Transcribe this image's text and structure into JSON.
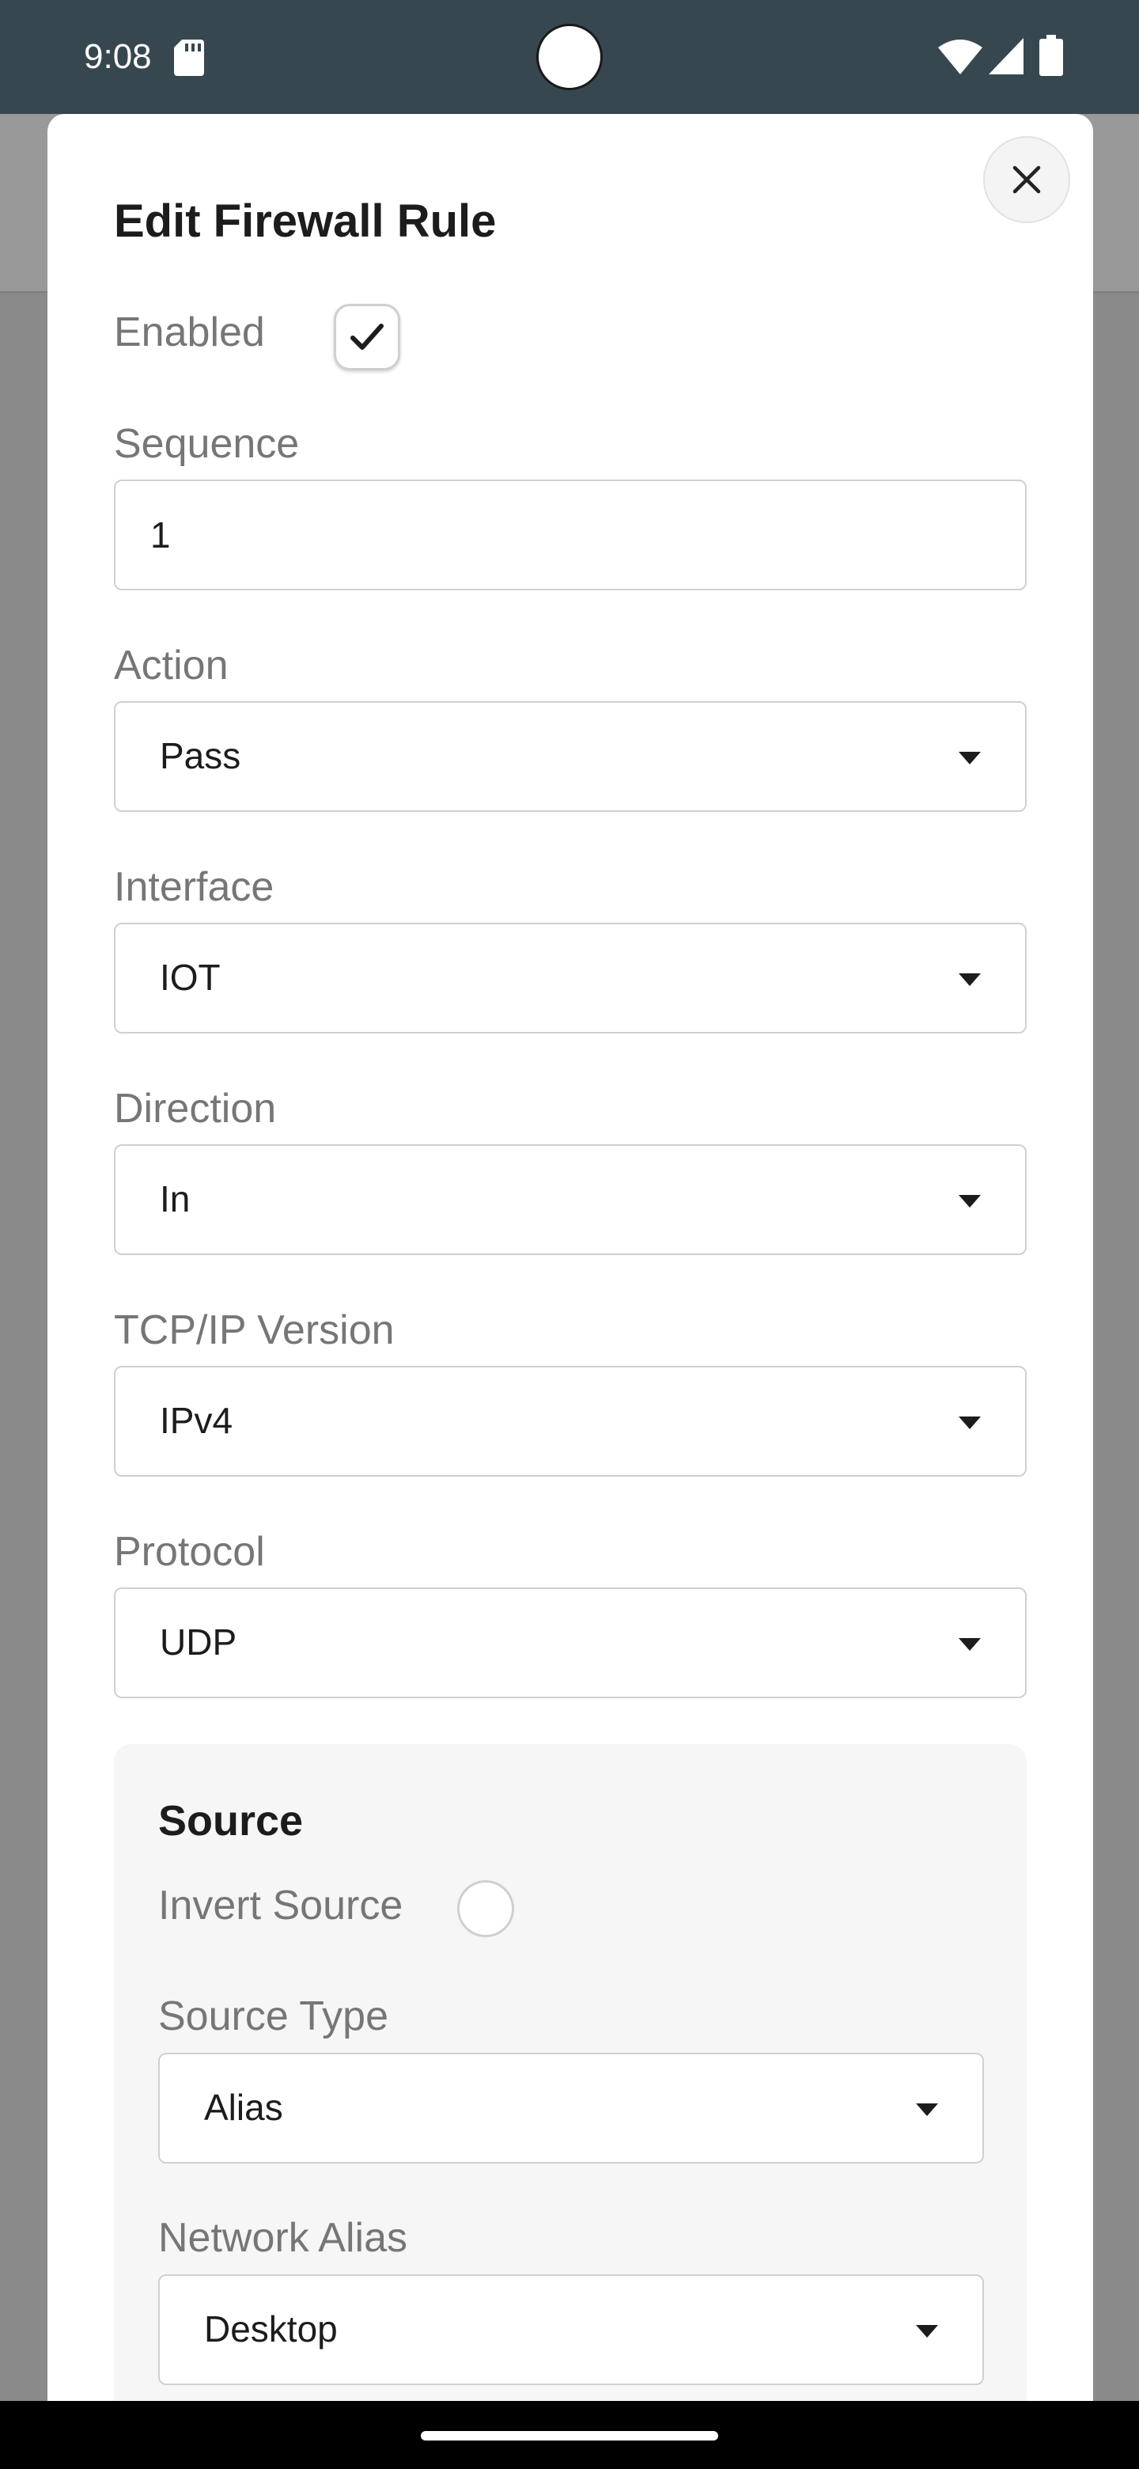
{
  "status_bar": {
    "time": "9:08"
  },
  "modal": {
    "title": "Edit Firewall Rule"
  },
  "form": {
    "enabled": {
      "label": "Enabled",
      "checked": true
    },
    "sequence": {
      "label": "Sequence",
      "value": "1"
    },
    "action": {
      "label": "Action",
      "value": "Pass"
    },
    "interface": {
      "label": "Interface",
      "value": "IOT"
    },
    "direction": {
      "label": "Direction",
      "value": "In"
    },
    "tcpip_version": {
      "label": "TCP/IP Version",
      "value": "IPv4"
    },
    "protocol": {
      "label": "Protocol",
      "value": "UDP"
    }
  },
  "source": {
    "heading": "Source",
    "invert": {
      "label": "Invert Source",
      "checked": false
    },
    "type": {
      "label": "Source Type",
      "value": "Alias"
    },
    "network_alias": {
      "label": "Network Alias",
      "value": "Desktop"
    }
  },
  "colors": {
    "status_bar": "#37474f",
    "scrim": "#8a8a8a",
    "modal_bg": "#ffffff",
    "label_text": "#767676",
    "panel_bg": "#f6f6f6"
  }
}
